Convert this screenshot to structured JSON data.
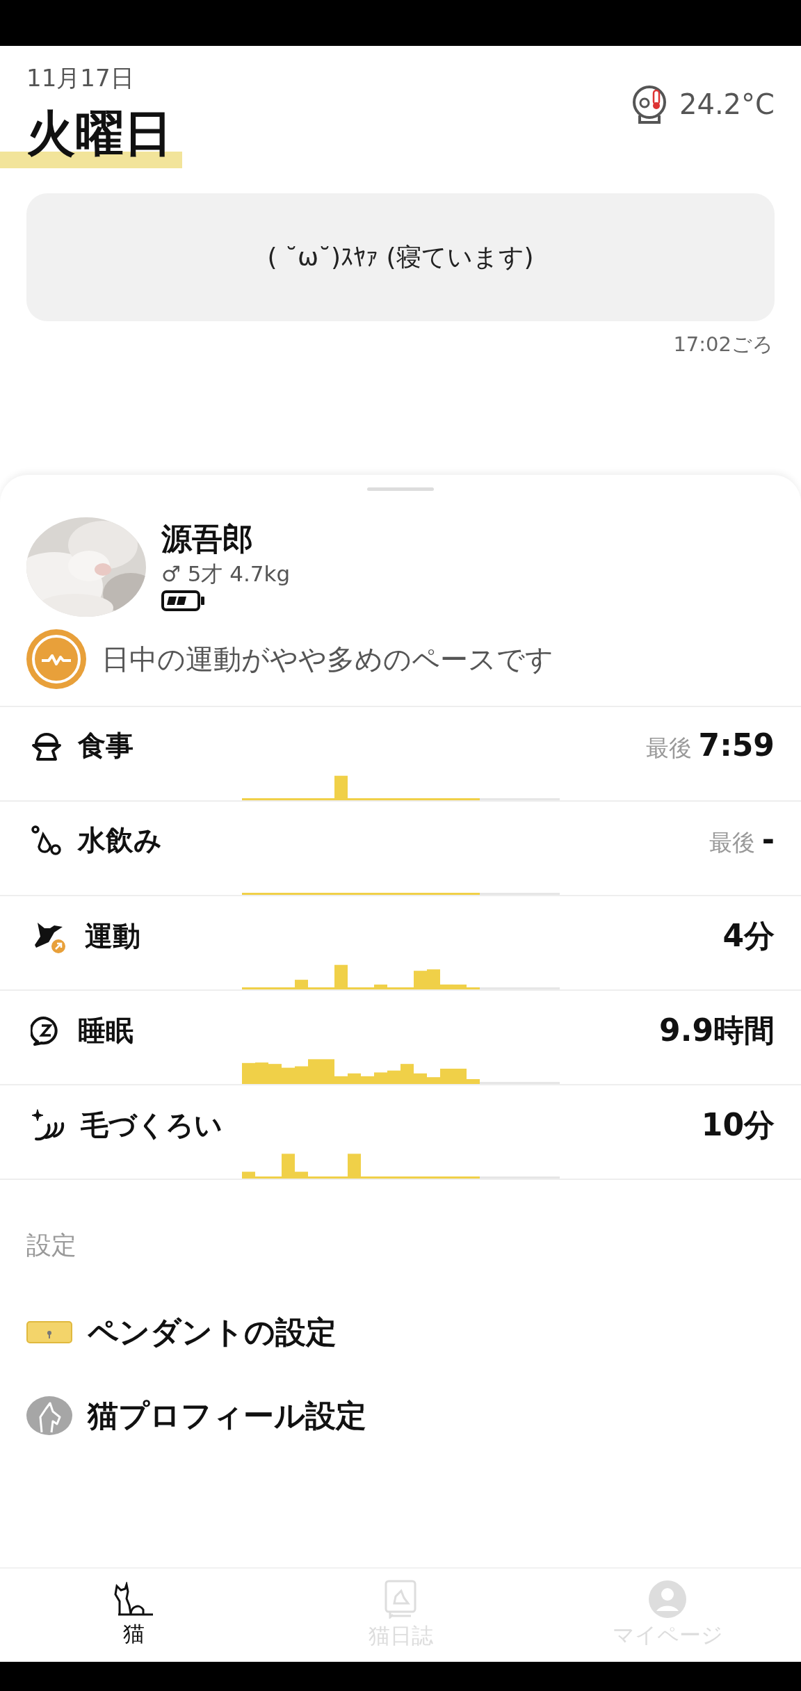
{
  "header": {
    "date": "11月17日",
    "weekday": "火曜日",
    "temperature": "24.2°C"
  },
  "status": {
    "message": "( ˘ω˘)ｽﾔｧ (寝ています)",
    "time": "17:02ごろ"
  },
  "cat": {
    "name": "源吾郎",
    "details": "♂ 5才 4.7kg",
    "insight": "日中の運動がやや多めのペースです"
  },
  "activities": [
    {
      "label": "食事",
      "prefix": "最後",
      "value": "7:59"
    },
    {
      "label": "水飲み",
      "prefix": "最後",
      "value": "-"
    },
    {
      "label": "運動",
      "value": "4分"
    },
    {
      "label": "睡眠",
      "value": "9.9時間"
    },
    {
      "label": "毛づくろい",
      "value": "10分"
    }
  ],
  "settings": {
    "heading": "設定",
    "items": [
      {
        "label": "ペンダントの設定"
      },
      {
        "label": "猫プロフィール設定"
      }
    ]
  },
  "nav": [
    {
      "label": "猫",
      "selected": true
    },
    {
      "label": "猫日誌",
      "selected": false
    },
    {
      "label": "マイページ",
      "selected": false
    }
  ]
}
